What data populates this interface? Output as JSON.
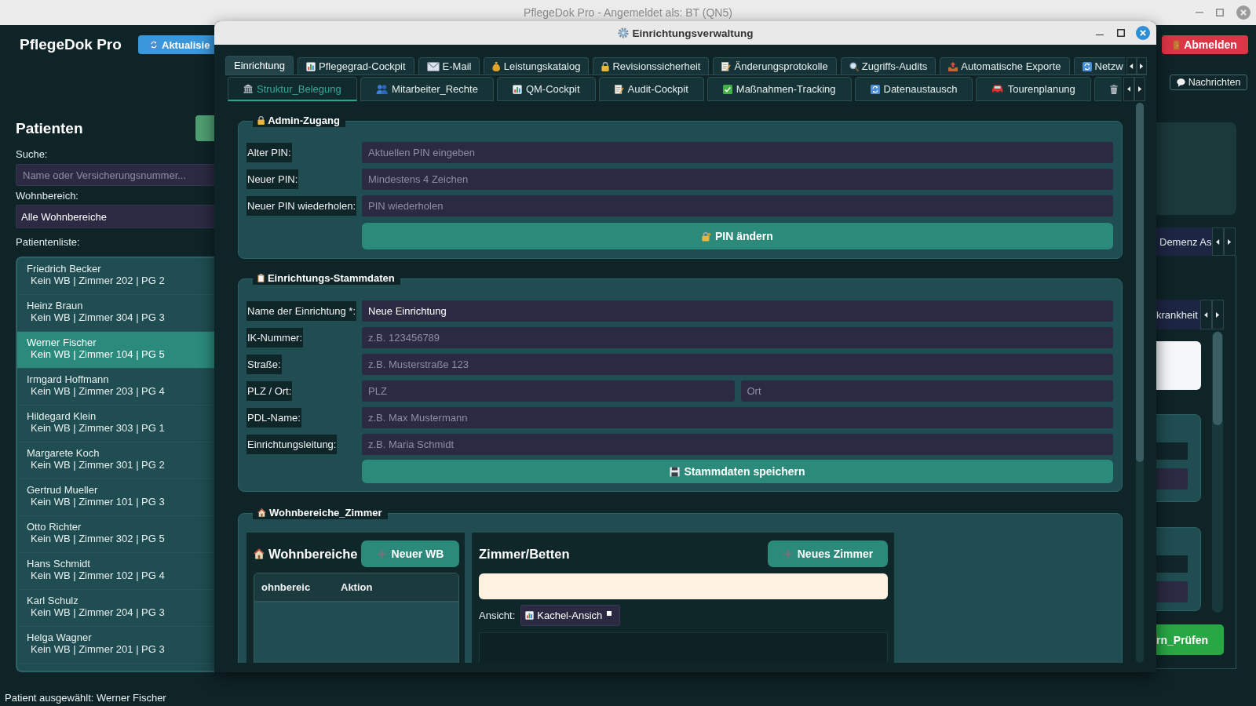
{
  "window": {
    "title": "PflegeDok Pro - Angemeldet als: BT (QN5)"
  },
  "header": {
    "app_title": "PflegeDok Pro",
    "refresh_button": "Aktualisie",
    "logout_button": "Abmelden",
    "messages_button": "Nachrichten"
  },
  "sidebar": {
    "heading": "Patienten",
    "search_label": "Suche:",
    "search": {
      "placeholder": "Name oder Versicherungsnummer..."
    },
    "ward_label": "Wohnbereich:",
    "ward_filter": {
      "value": "Alle Wohnbereiche"
    },
    "list_label": "Patientenliste:",
    "patients": [
      {
        "name": "Friedrich Becker",
        "details": "Kein WB | Zimmer 202 | PG 2",
        "selected": false
      },
      {
        "name": "Heinz Braun",
        "details": "Kein WB | Zimmer 304 | PG 3",
        "selected": false
      },
      {
        "name": "Werner Fischer",
        "details": "Kein WB | Zimmer 104 | PG 5",
        "selected": true
      },
      {
        "name": "Irmgard Hoffmann",
        "details": "Kein WB | Zimmer 203 | PG 4",
        "selected": false
      },
      {
        "name": "Hildegard Klein",
        "details": "Kein WB | Zimmer 303 | PG 1",
        "selected": false
      },
      {
        "name": "Margarete Koch",
        "details": "Kein WB | Zimmer 301 | PG 2",
        "selected": false
      },
      {
        "name": "Gertrud Mueller",
        "details": "Kein WB | Zimmer 101 | PG 3",
        "selected": false
      },
      {
        "name": "Otto Richter",
        "details": "Kein WB | Zimmer 302 | PG 5",
        "selected": false
      },
      {
        "name": "Hans Schmidt",
        "details": "Kein WB | Zimmer 102 | PG 4",
        "selected": false
      },
      {
        "name": "Karl Schulz",
        "details": "Kein WB | Zimmer 204 | PG 3",
        "selected": false
      },
      {
        "name": "Helga Wagner",
        "details": "Kein WB | Zimmer 201 | PG 3",
        "selected": false
      }
    ]
  },
  "right_panel": {
    "top_tab": "Demenz As",
    "inner_tab": "krankheit",
    "button": "rn_Prüfen"
  },
  "dialog": {
    "title": "Einrichtungsverwaltung",
    "tabs": [
      {
        "label": "Einrichtung",
        "selected": true
      },
      {
        "label": "Pflegegrad-Cockpit",
        "selected": false
      },
      {
        "label": "E-Mail",
        "selected": false
      },
      {
        "label": "Leistungskatalog",
        "selected": false
      },
      {
        "label": "Revisionssicherheit",
        "selected": false
      },
      {
        "label": "Änderungsprotokolle",
        "selected": false
      },
      {
        "label": "Zugriffs-Audits",
        "selected": false
      },
      {
        "label": "Automatische Exporte",
        "selected": false
      },
      {
        "label": "Netzw",
        "selected": false
      }
    ],
    "subtabs": [
      {
        "label": "Struktur_Belegung",
        "selected": true
      },
      {
        "label": "Mitarbeiter_Rechte",
        "selected": false
      },
      {
        "label": "QM-Cockpit",
        "selected": false
      },
      {
        "label": "Audit-Cockpit",
        "selected": false
      },
      {
        "label": "Maßnahmen-Tracking",
        "selected": false
      },
      {
        "label": "Datenaustausch",
        "selected": false
      },
      {
        "label": "Tourenplanung",
        "selected": false
      },
      {
        "selected": false
      }
    ],
    "admin_group": {
      "title": "Admin-Zugang",
      "fields": [
        {
          "label": "Alter PIN:",
          "inputs": [
            {
              "placeholder": "Aktuellen PIN eingeben"
            }
          ]
        },
        {
          "label": "Neuer PIN:",
          "inputs": [
            {
              "placeholder": "Mindestens 4 Zeichen"
            }
          ]
        },
        {
          "label": "Neuer PIN wiederholen:",
          "inputs": [
            {
              "placeholder": "PIN wiederholen"
            }
          ]
        }
      ],
      "button": "PIN ändern"
    },
    "master_data_group": {
      "title": "Einrichtungs-Stammdaten",
      "fields": [
        {
          "label": "Name der Einrichtung *:",
          "inputs": [
            {
              "value": "Neue Einrichtung"
            }
          ]
        },
        {
          "label": "IK-Nummer:",
          "inputs": [
            {
              "placeholder": "z.B. 123456789"
            }
          ]
        },
        {
          "label": "Straße:",
          "inputs": [
            {
              "placeholder": "z.B. Musterstraße 123"
            }
          ]
        },
        {
          "label": "PLZ / Ort:",
          "inputs": [
            {
              "placeholder": "PLZ"
            },
            {
              "placeholder": "Ort"
            }
          ]
        },
        {
          "label": "PDL-Name:",
          "inputs": [
            {
              "placeholder": "z.B. Max Mustermann"
            }
          ]
        },
        {
          "label": "Einrichtungsleitung:",
          "inputs": [
            {
              "placeholder": "z.B. Maria Schmidt"
            }
          ]
        }
      ],
      "button": "Stammdaten speichern"
    },
    "wards_group": {
      "title": "Wohnbereiche_Zimmer",
      "wards_panel": {
        "heading": "Wohnbereiche",
        "button": "Neuer WB",
        "columns": [
          "ohnbereic",
          "Aktion"
        ]
      },
      "rooms_panel": {
        "heading": "Zimmer/Betten",
        "button": "Neues Zimmer",
        "view_label": "Ansicht:",
        "view_select": {
          "value": "Kachel-Ansich"
        }
      }
    }
  },
  "status_bar": "Patient ausgewählt: Werner Fischer"
}
